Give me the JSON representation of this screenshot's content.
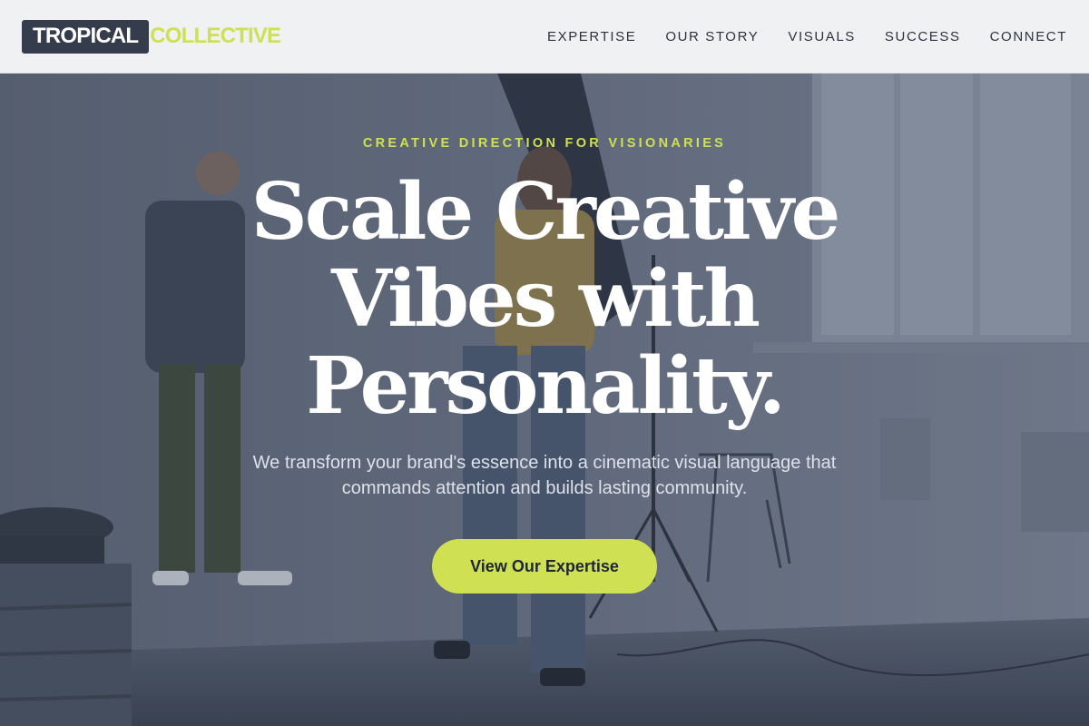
{
  "brand": {
    "primary": "TROPICAL",
    "accent": "COLLECTIVE",
    "colors": {
      "dark": "#353d4c",
      "lime": "#cfe052"
    }
  },
  "nav": {
    "items": [
      {
        "label": "EXPERTISE"
      },
      {
        "label": "OUR STORY"
      },
      {
        "label": "VISUALS"
      },
      {
        "label": "SUCCESS"
      },
      {
        "label": "CONNECT"
      }
    ]
  },
  "hero": {
    "eyebrow": "CREATIVE DIRECTION FOR VISIONARIES",
    "headline_lines": [
      "Scale Creative",
      "Vibes with",
      "Personality."
    ],
    "subtext": "We transform your brand's essence into a cinematic visual language that commands attention and builds lasting community.",
    "cta_label": "View Our Expertise",
    "background_image": "photo-studio-shoot"
  }
}
